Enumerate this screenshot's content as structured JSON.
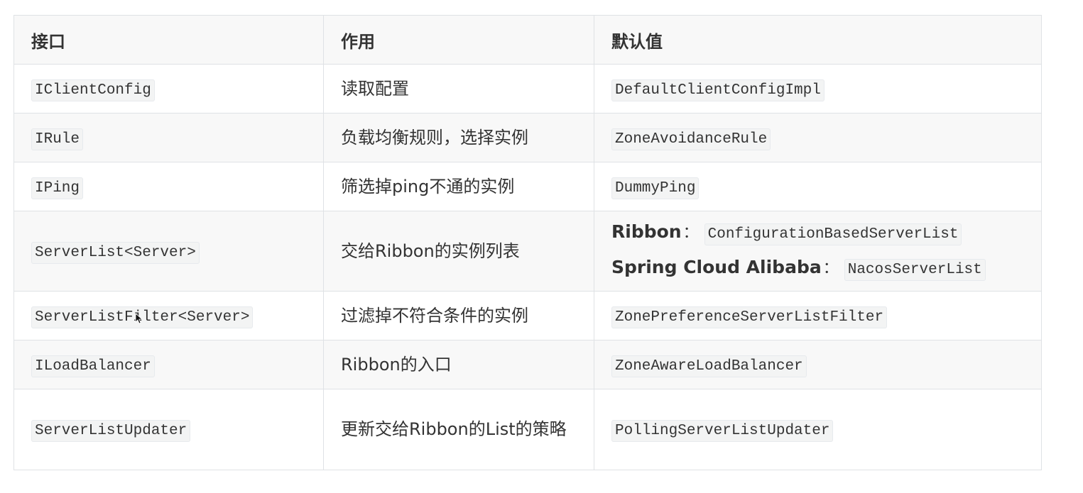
{
  "table": {
    "headers": [
      "接口",
      "作用",
      "默认值"
    ],
    "rows": [
      {
        "interface": "IClientConfig",
        "purpose": "读取配置",
        "default": "DefaultClientConfigImpl"
      },
      {
        "interface": "IRule",
        "purpose": "负载均衡规则，选择实例",
        "default": "ZoneAvoidanceRule"
      },
      {
        "interface": "IPing",
        "purpose": "筛选掉ping不通的实例",
        "default": "DummyPing"
      },
      {
        "interface": "ServerList<Server>",
        "purpose": "交给Ribbon的实例列表",
        "default_lines": [
          {
            "label": "Ribbon",
            "sep": "：",
            "value": "ConfigurationBasedServerList"
          },
          {
            "label": "Spring Cloud Alibaba",
            "sep": "：",
            "value": "NacosServerList"
          }
        ]
      },
      {
        "interface": "ServerListFilter<Server>",
        "purpose": "过滤掉不符合条件的实例",
        "default": "ZonePreferenceServerListFilter"
      },
      {
        "interface": "ILoadBalancer",
        "purpose": "Ribbon的入口",
        "default": "ZoneAwareLoadBalancer"
      },
      {
        "interface": "ServerListUpdater",
        "purpose": "更新交给Ribbon的List的策略",
        "default": "PollingServerListUpdater"
      }
    ]
  }
}
